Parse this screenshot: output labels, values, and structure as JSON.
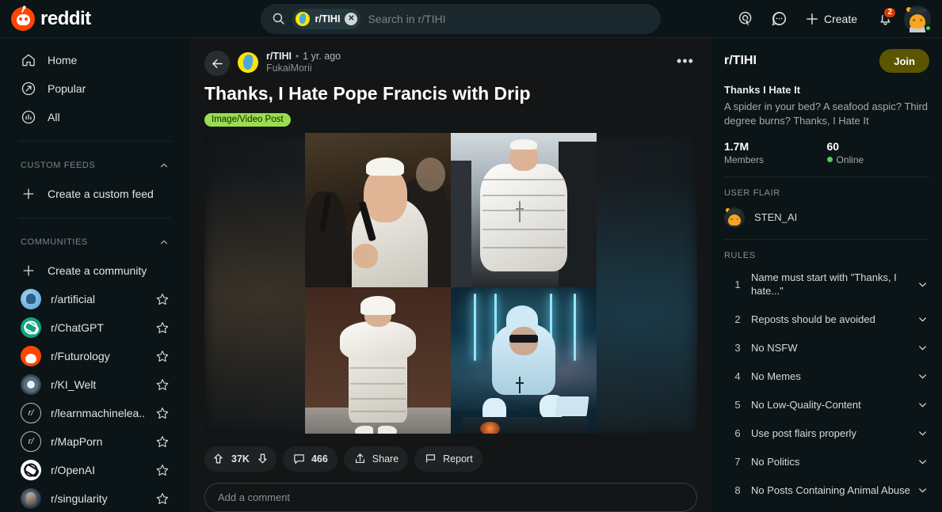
{
  "header": {
    "logo_text": "reddit",
    "search": {
      "chip_label": "r/TIHI",
      "placeholder": "Search in r/TIHI"
    },
    "create_label": "Create",
    "notification_count": "2",
    "icons": {
      "search": "search-icon",
      "advertise": "advertise-icon",
      "chat": "chat-icon",
      "plus": "plus-icon",
      "bell": "bell-icon",
      "avatar": "user-avatar"
    }
  },
  "sidebar": {
    "nav": [
      {
        "label": "Home",
        "icon": "home-icon"
      },
      {
        "label": "Popular",
        "icon": "popular-icon"
      },
      {
        "label": "All",
        "icon": "all-icon"
      }
    ],
    "custom_feeds": {
      "header": "CUSTOM FEEDS",
      "create_label": "Create a custom feed"
    },
    "communities": {
      "header": "COMMUNITIES",
      "create_label": "Create a community",
      "items": [
        {
          "name": "r/artificial",
          "avatar": "av-artificial"
        },
        {
          "name": "r/ChatGPT",
          "avatar": "av-chatgpt"
        },
        {
          "name": "r/Futurology",
          "avatar": "av-futurology"
        },
        {
          "name": "r/KI_Welt",
          "avatar": "av-kiwelt"
        },
        {
          "name": "r/learnmachinelea...",
          "avatar": "av-generic"
        },
        {
          "name": "r/MapPorn",
          "avatar": "av-generic"
        },
        {
          "name": "r/OpenAI",
          "avatar": "av-openai"
        },
        {
          "name": "r/singularity",
          "avatar": "av-singularity"
        }
      ]
    }
  },
  "post": {
    "subreddit": "r/TIHI",
    "dot": "•",
    "timestamp": "1 yr. ago",
    "author": "FukaiMorii",
    "title": "Thanks, I Hate Pope Francis with Drip",
    "flair": "Image/Video Post",
    "more_label": "•••",
    "actions": {
      "upvote_count": "37K",
      "comment_count": "466",
      "share_label": "Share",
      "report_label": "Report"
    },
    "comment_placeholder": "Add a comment",
    "media": {
      "type": "image-collage",
      "panels": [
        "pope-with-microphone",
        "pope-in-white-puffer-jacket",
        "pope-walking-in-long-puffer-coat",
        "pope-as-dj-in-nightclub"
      ]
    }
  },
  "rightbar": {
    "title": "r/TIHI",
    "join_label": "Join",
    "sub_title": "Thanks I Hate It",
    "description": "A spider in your bed? A seafood aspic? Third degree burns? Thanks, I Hate It",
    "members_count": "1.7M",
    "members_label": "Members",
    "online_count": "60",
    "online_label": "Online",
    "user_flair_header": "USER FLAIR",
    "user_flair_name": "STEN_AI",
    "rules_header": "RULES",
    "rules": [
      {
        "n": "1",
        "text": "Name must start with \"Thanks, I hate...\""
      },
      {
        "n": "2",
        "text": "Reposts should be avoided"
      },
      {
        "n": "3",
        "text": "No NSFW"
      },
      {
        "n": "4",
        "text": "No Memes"
      },
      {
        "n": "5",
        "text": "No Low-Quality-Content"
      },
      {
        "n": "6",
        "text": "Use post flairs properly"
      },
      {
        "n": "7",
        "text": "No Politics"
      },
      {
        "n": "8",
        "text": "No Posts Containing Animal Abuse"
      }
    ]
  },
  "colors": {
    "brand": "#ff4500",
    "flair_green": "#9ade4f",
    "join_olive": "#5b5500",
    "online_green": "#46d160",
    "badge_red": "#d93900"
  }
}
